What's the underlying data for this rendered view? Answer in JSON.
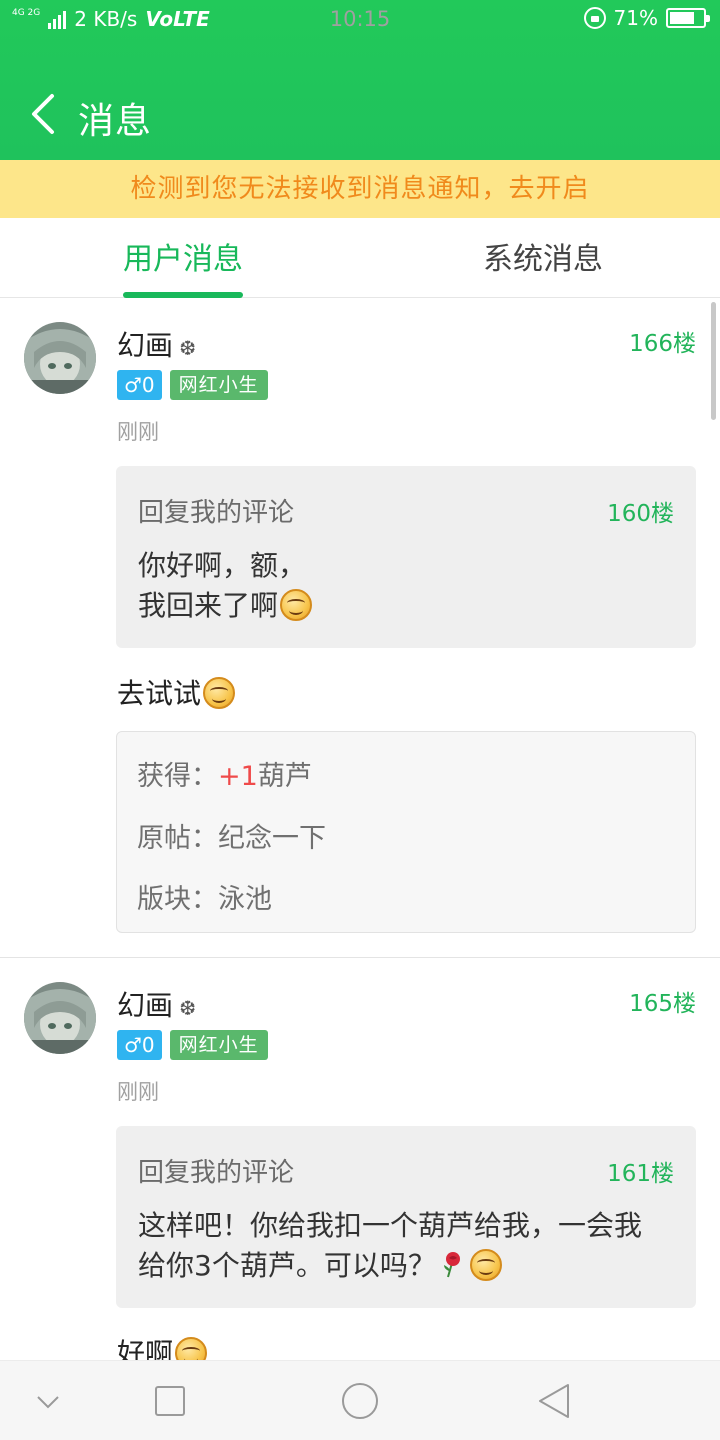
{
  "status_bar": {
    "network_small": "4G 2G",
    "speed": "2 KB/s",
    "volte": "VoLTE",
    "time": "10:15",
    "battery": "71%"
  },
  "header": {
    "title": "消息"
  },
  "banner": {
    "text": "检测到您无法接收到消息通知，去开启"
  },
  "tabs": [
    {
      "label": "用户消息",
      "active": true
    },
    {
      "label": "系统消息",
      "active": false
    }
  ],
  "messages": [
    {
      "user": "幻画",
      "floor": "166楼",
      "gender_badge": "♂0",
      "title_badge": "网红小生",
      "time": "刚刚",
      "quote": {
        "label": "回复我的评论",
        "floor": "160楼",
        "line1": "你好啊，额，",
        "line2": "我回来了啊"
      },
      "reply": "去试试",
      "reward": {
        "label": "获得：",
        "plus": "+1",
        "unit": "葫芦",
        "post_label": "原帖：",
        "post": "纪念一下",
        "board_label": "版块：",
        "board": "泳池"
      }
    },
    {
      "user": "幻画",
      "floor": "165楼",
      "gender_badge": "♂0",
      "title_badge": "网红小生",
      "time": "刚刚",
      "quote": {
        "label": "回复我的评论",
        "floor": "161楼",
        "line1": "这样吧！你给我扣一个葫芦给我，一会我",
        "line2": "给你3个葫芦。可以吗？"
      },
      "reply": "好啊"
    }
  ],
  "icons": {
    "back": "chevron-left-icon",
    "nav_down": "chevron-down-icon",
    "nav_recents": "square-icon",
    "nav_home": "circle-icon",
    "nav_back": "triangle-back-icon"
  },
  "colors": {
    "header_green": "#1fc25c",
    "accent_green": "#18b85a",
    "banner_bg": "#fde68a",
    "banner_text": "#f08a1c",
    "gender_blue": "#2fb4f0",
    "badge_green": "#5ab86c",
    "plus_red": "#ef4a4a"
  }
}
